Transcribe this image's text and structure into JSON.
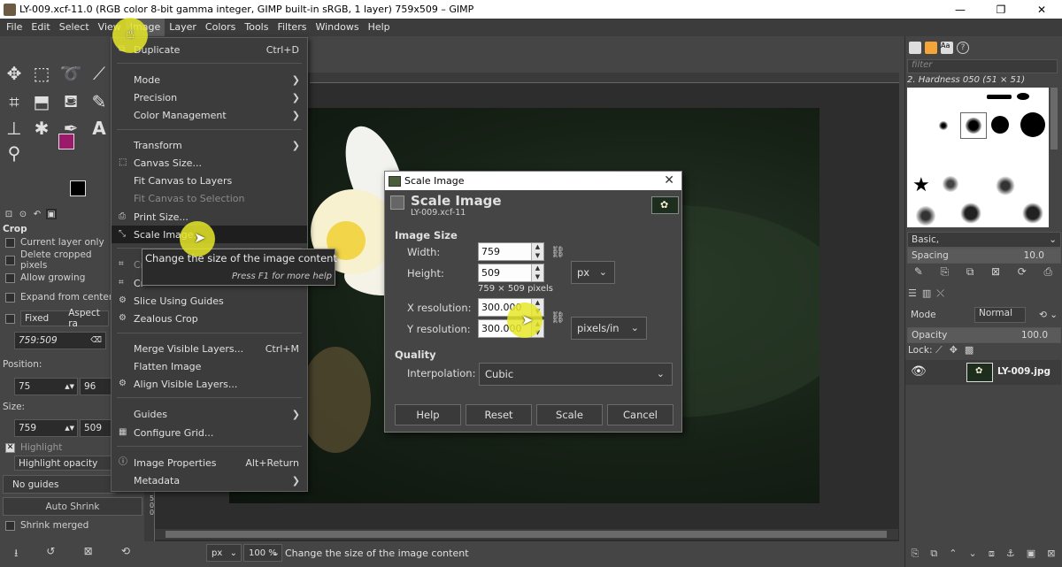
{
  "window": {
    "title": "LY-009.xcf-11.0 (RGB color 8-bit gamma integer, GIMP built-in sRGB, 1 layer) 759x509 – GIMP",
    "min": "—",
    "max": "❐",
    "close": "✕"
  },
  "menubar": [
    "File",
    "Edit",
    "Select",
    "View",
    "Image",
    "Layer",
    "Colors",
    "Tools",
    "Filters",
    "Windows",
    "Help"
  ],
  "image_menu": {
    "duplicate": "Duplicate",
    "duplicate_shortcut": "Ctrl+D",
    "mode": "Mode",
    "precision": "Precision",
    "color_management": "Color Management",
    "transform": "Transform",
    "canvas_size": "Canvas Size...",
    "fit_canvas_layers": "Fit Canvas to Layers",
    "fit_canvas_selection": "Fit Canvas to Selection",
    "print_size": "Print Size...",
    "scale_image": "Scale Image...",
    "crop_partial_1": "Cr",
    "crop_partial_2": "Cr",
    "slice_guides": "Slice Using Guides",
    "zealous_crop": "Zealous Crop",
    "merge_visible": "Merge Visible Layers...",
    "merge_visible_shortcut": "Ctrl+M",
    "flatten": "Flatten Image",
    "align_visible": "Align Visible Layers...",
    "guides": "Guides",
    "configure_grid": "Configure Grid...",
    "image_properties": "Image Properties",
    "image_properties_shortcut": "Alt+Return",
    "metadata": "Metadata"
  },
  "tooltip": {
    "main": "Change the size of the image content",
    "help": "Press F1 for more help"
  },
  "tool_options": {
    "title": "Crop",
    "current_layer_only": "Current layer only",
    "delete_cropped": "Delete cropped pixels",
    "allow_growing": "Allow growing",
    "expand_from_center": "Expand from center",
    "fixed": "Fixed",
    "aspect": "Aspect ra",
    "ratio_value": "759:509",
    "position_label": "Position:",
    "pos_x": "75",
    "pos_y": "96",
    "size_label": "Size:",
    "size_w": "759",
    "size_h": "509",
    "highlight": "Highlight",
    "highlight_opacity": "Highlight opacity",
    "guides": "No guides",
    "auto_shrink": "Auto Shrink",
    "shrink_merged": "Shrink merged"
  },
  "dialog": {
    "window_title": "Scale Image",
    "heading": "Scale Image",
    "subheading": "LY-009.xcf-11",
    "image_size": "Image Size",
    "width_label": "Width:",
    "width_value": "759",
    "height_label": "Height:",
    "height_value": "509",
    "pixels_note": "759 × 509 pixels",
    "unit": "px",
    "xres_label": "X resolution:",
    "xres_value": "300.000",
    "yres_label": "Y resolution:",
    "yres_value": "300.000",
    "res_unit": "pixels/in",
    "quality": "Quality",
    "interp_label": "Interpolation:",
    "interp_value": "Cubic",
    "btn_help": "Help",
    "btn_reset": "Reset",
    "btn_scale": "Scale",
    "btn_cancel": "Cancel"
  },
  "statusbar": {
    "unit": "px",
    "zoom": "100 %",
    "message": "Change the size of the image content"
  },
  "dock": {
    "filter_placeholder": "filter",
    "brush_name": "2. Hardness 050 (51 × 51)",
    "preset": "Basic,",
    "spacing_label": "Spacing",
    "spacing_value": "10.0",
    "mode_label": "Mode",
    "mode_value": "Normal",
    "opacity_label": "Opacity",
    "opacity_value": "100.0",
    "lock_label": "Lock:",
    "layer_name": "LY-009.jpg"
  },
  "colors": {
    "foreground": "#9b1a6a",
    "background": "#000000",
    "highlight_mark": "#e6e628"
  }
}
